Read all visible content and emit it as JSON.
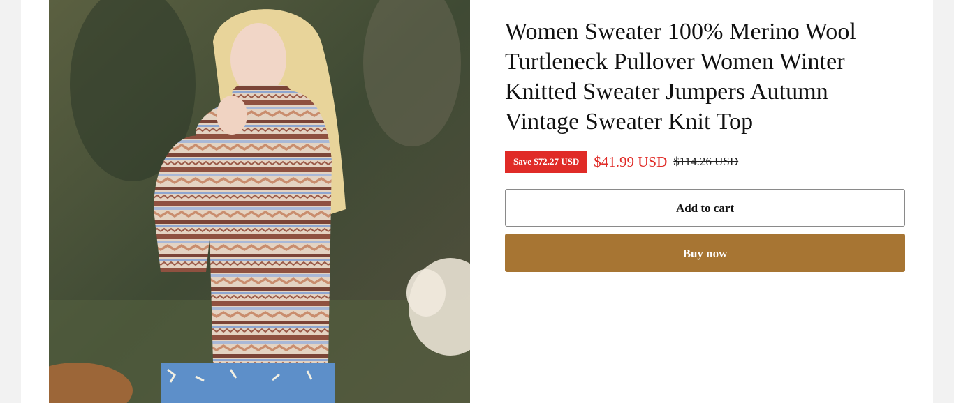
{
  "product": {
    "title": "Women Sweater 100% Merino Wool Turtleneck Pullover Women Winter Knitted Sweater Jumpers Autumn Vintage Sweater Knit Top",
    "save_label": "Save $72.27 USD",
    "sale_price": "$41.99 USD",
    "compare_price": "$114.26 USD",
    "image_alt": "Woman wearing a fair isle turtleneck sweater"
  },
  "actions": {
    "add_to_cart": "Add to cart",
    "buy_now": "Buy now"
  },
  "colors": {
    "sale_red": "#e02b27",
    "buy_now_bg": "#a77533",
    "page_bg": "#f2f2f2"
  }
}
